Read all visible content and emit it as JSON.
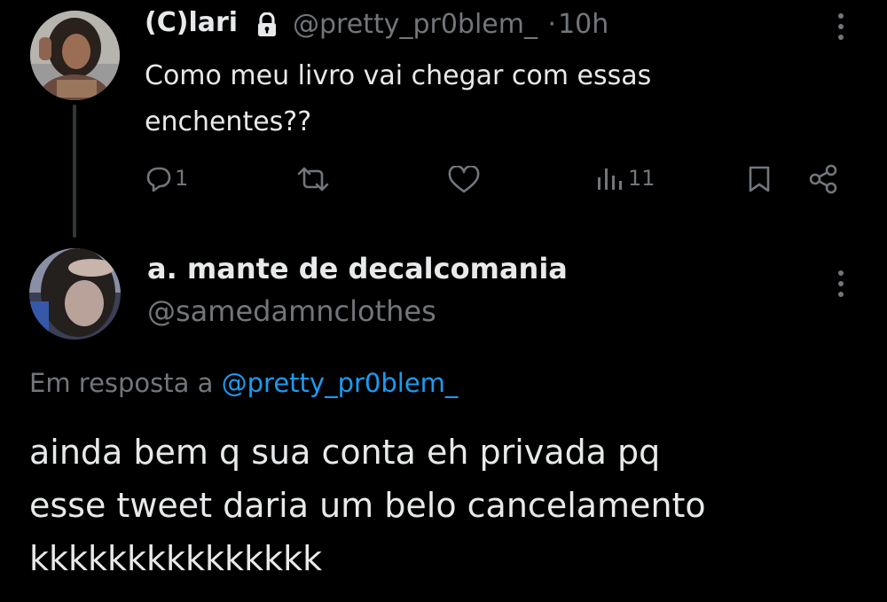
{
  "tweet": {
    "display_name": "(C)lari",
    "handle": "@pretty_pr0blem_",
    "separator": "·",
    "time": "10h",
    "text": "Como meu livro vai chegar com essas enchentes??",
    "avatar_icon": "avatar-photo",
    "protected_icon": "lock-icon",
    "more_icon": "more-vertical-icon",
    "actions": {
      "reply_count": "1",
      "retweet_count": "",
      "like_count": "",
      "views_count": "11"
    }
  },
  "reply": {
    "display_name": "a. mante de decalcomania",
    "handle": "@samedamnclothes",
    "replying_prefix": "Em resposta a",
    "replying_mention": "@pretty_pr0blem_",
    "text": "ainda bem q sua conta eh privada pq\nesse tweet daria um belo cancelamento\nkkkkkkkkkkkkkkk",
    "avatar_icon": "avatar-photo",
    "more_icon": "more-vertical-icon"
  },
  "colors": {
    "background": "#000000",
    "text": "#e7e9ea",
    "secondary": "#71767b",
    "link": "#1d9bf0"
  }
}
